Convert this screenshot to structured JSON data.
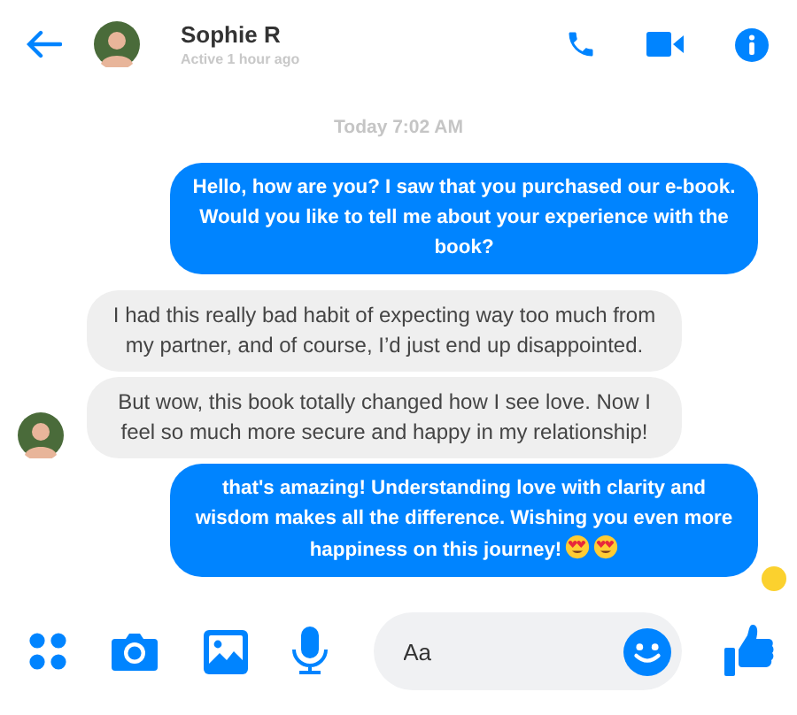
{
  "contact": {
    "name": "Sophie R",
    "status": "Active 1 hour ago"
  },
  "timestamp": "Today 7:02 AM",
  "messages": [
    {
      "kind": "sent",
      "text": "Hello, how are you? I saw that you purchased our e-book. Would you like to tell me about your experience with the book?"
    },
    {
      "kind": "received",
      "text": "I had this really bad habit of expecting way too much from my partner, and of course, I’d just end up disappointed."
    },
    {
      "kind": "received",
      "text": "But wow, this book totally changed how I see love. Now I feel so much more secure and happy in my relationship!",
      "avatar": true
    },
    {
      "kind": "sent",
      "text": "that's amazing! Understanding love with clarity and wisdom makes all the difference. Wishing you even more happiness on this journey!",
      "seen": true,
      "emojis": [
        {
          "kind": "heart_eyes"
        },
        {
          "kind": "heart_eyes"
        }
      ]
    }
  ],
  "composer": {
    "placeholder": "Aa"
  }
}
